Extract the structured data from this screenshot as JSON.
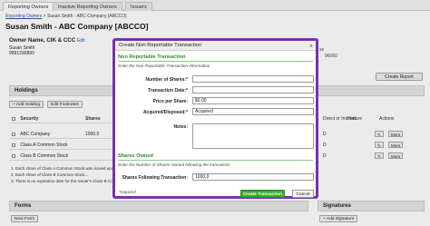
{
  "tabs": [
    "Reporting Owners",
    "Inactive Reporting Owners",
    "Issuers"
  ],
  "breadcrumb": {
    "root": "Reporting Owners",
    "sep": " > ",
    "current": "Susan Smith - ABC Company [ABCCO]"
  },
  "page_title": "Susan Smith - ABC Company [ABCCO]",
  "owner": {
    "heading": "Owner Name, CIK & CCC",
    "edit": "Edit",
    "name": "Susan Smith",
    "cik": "9991230893"
  },
  "right_side": {
    "ss": "ss",
    "zip": "96060"
  },
  "create_report": "Create Report",
  "holdings": {
    "title": "Holdings",
    "add_holding": "+ Add Holding",
    "edit_footnotes": "Edit Footnotes",
    "col_security": "Security",
    "col_shares": "Shares",
    "rows": [
      {
        "security": "ABC Company",
        "shares": "1000.0"
      },
      {
        "security": "Class A Common Stock",
        "shares": ""
      },
      {
        "security": "Class B Common Stock",
        "shares": ""
      }
    ],
    "right_cols": [
      "Direct or Indirect",
      "Nature",
      "Actions"
    ],
    "right_values": [
      "D",
      "D",
      "D"
    ],
    "more": "More",
    "footnotes": [
      "1. Each share of Class A Common Stock was issued upon the...",
      "2. Each share of Class B Common Stock...",
      "3. There is no expiration date for the Issuer's Class B Common..."
    ]
  },
  "forms": {
    "title": "Forms",
    "new_form": "New Form"
  },
  "signatures": {
    "title": "Signatures",
    "add": "+ Add Signature"
  },
  "modal": {
    "title": "Create Non Reportable Transaction",
    "close": "×",
    "section1": "Non Reportable Transaction",
    "section1_note": "Enter the Non Reportable Transaction Information",
    "fields": {
      "shares_label": "Number of Shares:*",
      "shares_value": "",
      "date_label": "Transaction Date:*",
      "date_value": "",
      "price_label": "Price per Share:",
      "price_value": "$0.00",
      "acq_label": "Acquired/Disposed:*",
      "acq_value": "Acquired",
      "notes_label": "Notes:"
    },
    "section2": "Shares Owned",
    "section2_note": "Enter the Number of Shares Owned following the transaction",
    "following_label": "Shares Following Transaction:",
    "following_value": "1000.0",
    "required_note": "*required",
    "create_button": "Create Transaction",
    "cancel_button": "Cancel"
  }
}
